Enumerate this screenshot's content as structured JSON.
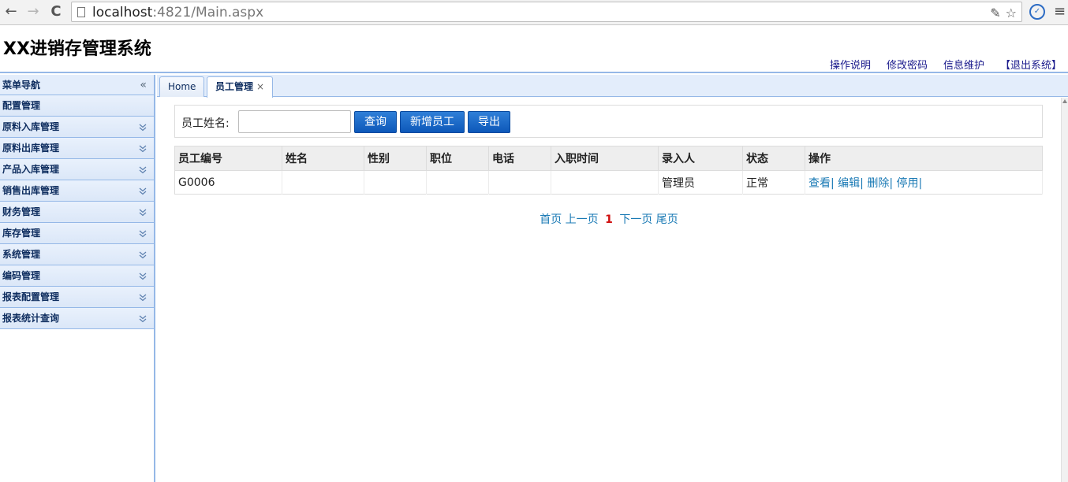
{
  "browser": {
    "back_glyph": "←",
    "forward_glyph": "→",
    "reload_glyph": "C",
    "url_host": "localhost",
    "url_rest": ":4821/Main.aspx",
    "key_glyph": "✎",
    "star_glyph": "☆",
    "menu_glyph": "≡"
  },
  "header": {
    "title": "XX进销存管理系统",
    "links": [
      "操作说明",
      "修改密码",
      "信息维护",
      "【退出系统】"
    ]
  },
  "sidebar": {
    "title": "菜单导航",
    "collapse_glyph": "«",
    "items": [
      "配置管理",
      "原料入库管理",
      "原料出库管理",
      "产品入库管理",
      "销售出库管理",
      "财务管理",
      "库存管理",
      "系统管理",
      "编码管理",
      "报表配置管理",
      "报表统计查询"
    ]
  },
  "tabs": [
    {
      "label": "Home"
    },
    {
      "label": "员工管理",
      "close": "×"
    }
  ],
  "search": {
    "label": "员工姓名:",
    "value": "",
    "placeholder": "",
    "buttons": [
      "查询",
      "新增员工",
      "导出"
    ]
  },
  "table": {
    "columns": [
      "员工编号",
      "姓名",
      "性别",
      "职位",
      "电话",
      "入职时间",
      "录入人",
      "状态",
      "操作"
    ],
    "rows": [
      {
        "cells": [
          "G0006",
          "",
          "",
          "",
          "",
          "",
          "管理员",
          "正常"
        ],
        "actions": [
          "查看",
          "编辑",
          "删除",
          "停用"
        ]
      }
    ]
  },
  "pager": {
    "first": "首页",
    "prev": "上一页",
    "current": "1",
    "next": "下一页",
    "last": "尾页"
  },
  "colors": {
    "accent": "#95b8e7",
    "button": "#0d58b9",
    "link": "#1a7ab5",
    "current_page": "#d01010"
  }
}
